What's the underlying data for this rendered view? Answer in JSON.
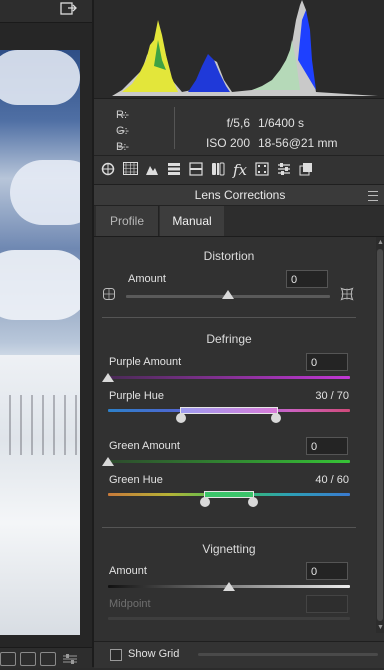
{
  "camera": {
    "r_label": "R:",
    "g_label": "G:",
    "b_label": "B:",
    "r_value": "---",
    "g_value": "---",
    "b_value": "---",
    "aperture": "f/5,6",
    "shutter": "1/6400 s",
    "iso": "ISO 200",
    "lens": "18-56@21 mm"
  },
  "toolbar_icons": [
    "basic-icon",
    "tone-curve-icon",
    "detail-icon",
    "hsl-icon",
    "split-toning-icon",
    "lens-corrections-icon",
    "effects-icon",
    "camera-calibration-icon",
    "presets-icon",
    "snapshots-icon"
  ],
  "panel": {
    "title": "Lens Corrections",
    "tabs": {
      "profile": "Profile",
      "manual": "Manual"
    }
  },
  "distortion": {
    "title": "Distortion",
    "amount_label": "Amount",
    "amount_value": "0",
    "amount_level": 0.5
  },
  "defringe": {
    "title": "Defringe",
    "purple_amount_label": "Purple Amount",
    "purple_amount_value": "0",
    "purple_hue_label": "Purple Hue",
    "purple_hue_value": "30 / 70",
    "purple_hue_range": [
      30,
      70
    ],
    "green_amount_label": "Green Amount",
    "green_amount_value": "0",
    "green_hue_label": "Green Hue",
    "green_hue_value": "40 / 60",
    "green_hue_range": [
      40,
      60
    ]
  },
  "vignetting": {
    "title": "Vignetting",
    "amount_label": "Amount",
    "amount_value": "0",
    "amount_level": 0.5,
    "midpoint_label": "Midpoint",
    "midpoint_value": ""
  },
  "bottom": {
    "show_grid_label": "Show Grid",
    "show_grid_checked": false
  }
}
